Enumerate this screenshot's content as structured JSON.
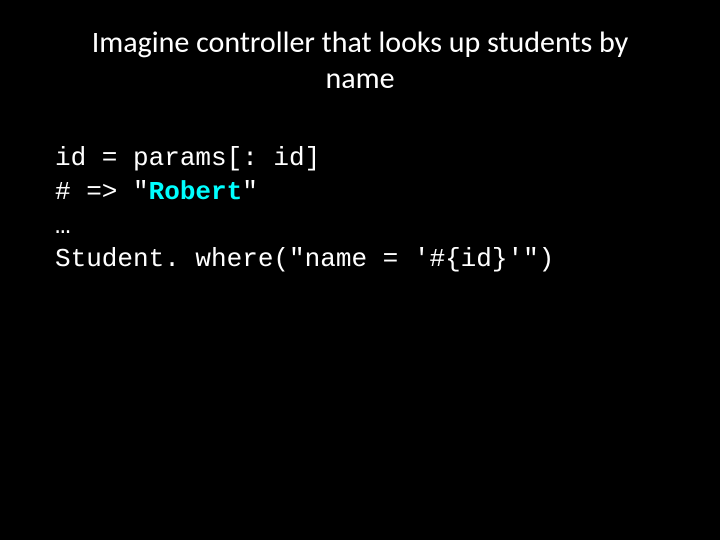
{
  "title": "Imagine controller that looks up students by name",
  "code": {
    "line1": "id = params[: id]",
    "line2_prefix": "# => \"",
    "line2_highlight": "Robert",
    "line2_suffix": "\"",
    "line3": "…",
    "line4": "Student. where(\"name = '#{id}'\")"
  }
}
